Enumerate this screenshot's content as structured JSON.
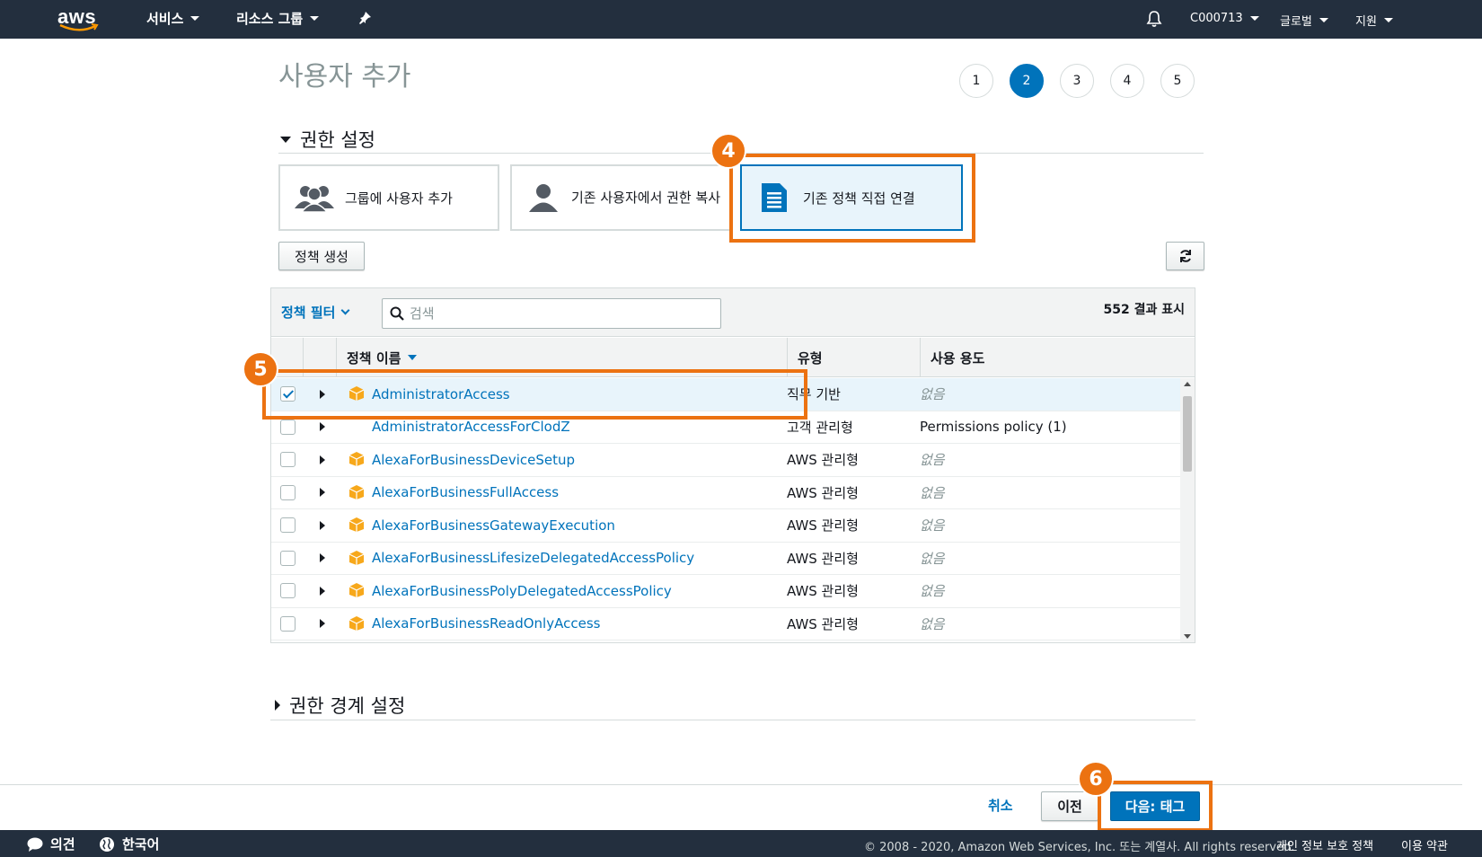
{
  "nav": {
    "logo": "aws",
    "services": "서비스",
    "resource_groups": "리소스 그룹",
    "account": "C000713",
    "region": "글로벌",
    "support": "지원"
  },
  "page": {
    "title": "사용자 추가",
    "steps": [
      "1",
      "2",
      "3",
      "4",
      "5"
    ],
    "active_step": "2"
  },
  "permissions": {
    "section_title": "권한 설정",
    "options": [
      {
        "label": "그룹에 사용자 추가",
        "icon": "group-icon"
      },
      {
        "label": "기존 사용자에서 권한 복사",
        "icon": "user-icon"
      },
      {
        "label": "기존 정책 직접 연결",
        "icon": "document-icon"
      }
    ],
    "create_policy": "정책 생성",
    "refresh_icon": "refresh-icon"
  },
  "table": {
    "filter_label": "정책 필터",
    "search_placeholder": "검색",
    "result_count": "552 결과 표시",
    "columns": [
      "정책 이름",
      "유형",
      "사용 용도"
    ],
    "rows": [
      {
        "name": "AdministratorAccess",
        "type": "직무 기반",
        "usage": "없음",
        "checked": true,
        "icon": true
      },
      {
        "name": "AdministratorAccessForClodZ",
        "type": "고객 관리형",
        "usage": "Permissions policy (1)",
        "checked": false,
        "icon": false
      },
      {
        "name": "AlexaForBusinessDeviceSetup",
        "type": "AWS 관리형",
        "usage": "없음",
        "checked": false,
        "icon": true
      },
      {
        "name": "AlexaForBusinessFullAccess",
        "type": "AWS 관리형",
        "usage": "없음",
        "checked": false,
        "icon": true
      },
      {
        "name": "AlexaForBusinessGatewayExecution",
        "type": "AWS 관리형",
        "usage": "없음",
        "checked": false,
        "icon": true
      },
      {
        "name": "AlexaForBusinessLifesizeDelegatedAccessPolicy",
        "type": "AWS 관리형",
        "usage": "없음",
        "checked": false,
        "icon": true
      },
      {
        "name": "AlexaForBusinessPolyDelegatedAccessPolicy",
        "type": "AWS 관리형",
        "usage": "없음",
        "checked": false,
        "icon": true
      },
      {
        "name": "AlexaForBusinessReadOnlyAccess",
        "type": "AWS 관리형",
        "usage": "없음",
        "checked": false,
        "icon": true
      }
    ]
  },
  "boundary": {
    "section_title": "권한 경계 설정"
  },
  "annotations": [
    "4",
    "5",
    "6"
  ],
  "actions": {
    "cancel": "취소",
    "previous": "이전",
    "next": "다음: 태그"
  },
  "footer": {
    "feedback": "의견",
    "language": "한국어",
    "copyright": "© 2008 - 2020, Amazon Web Services, Inc. 또는 계열사. All rights reserved.",
    "privacy": "개인 정보 보호 정책",
    "terms": "이용 약관"
  },
  "colors": {
    "nav_bg": "#232f3e",
    "accent": "#0073bb",
    "highlight": "#ec7211",
    "policy_icon": "#f7a81b"
  }
}
